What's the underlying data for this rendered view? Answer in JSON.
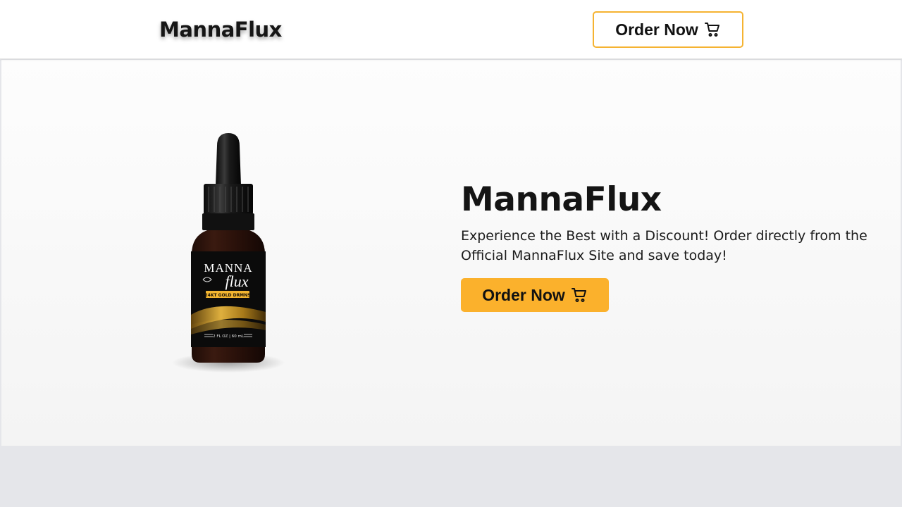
{
  "header": {
    "brand": "MannaFlux",
    "order_button_label": "Order Now"
  },
  "hero": {
    "title": "MannaFlux",
    "description": "Experience the Best with a Discount! Order directly from the Official MannaFlux Site and save today!",
    "order_button_label": "Order Now",
    "product_label": {
      "line1": "MANNA",
      "line2": "flux",
      "badge": "24KT GOLD DRMNS",
      "volume": "2 FL OZ | 60 mL"
    }
  },
  "colors": {
    "accent": "#fbb12c",
    "header_button_border": "#f5b331",
    "text": "#141414",
    "footer_band": "#e5e6ea"
  },
  "icons": {
    "cart": "cart-icon"
  }
}
